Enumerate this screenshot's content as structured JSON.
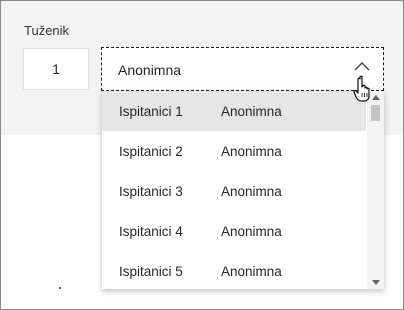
{
  "field": {
    "label": "Tuženik",
    "number_value": "1",
    "combo_value": "Anonimna"
  },
  "dropdown": {
    "options": [
      {
        "name": "Ispitanici 1",
        "value": "Anonimna",
        "selected": true
      },
      {
        "name": "Ispitanici 2",
        "value": "Anonimna",
        "selected": false
      },
      {
        "name": "Ispitanici 3",
        "value": "Anonimna",
        "selected": false
      },
      {
        "name": "Ispitanici 4",
        "value": "Anonimna",
        "selected": false
      },
      {
        "name": "Ispitanici 5",
        "value": "Anonimna",
        "selected": false
      }
    ]
  },
  "icons": {
    "chevron": "chevron-up-icon",
    "cursor": "hand-pointer-icon"
  },
  "colors": {
    "panel_bg": "#f3f3f3",
    "selected_bg": "#e6e6e6",
    "text": "#262626"
  }
}
